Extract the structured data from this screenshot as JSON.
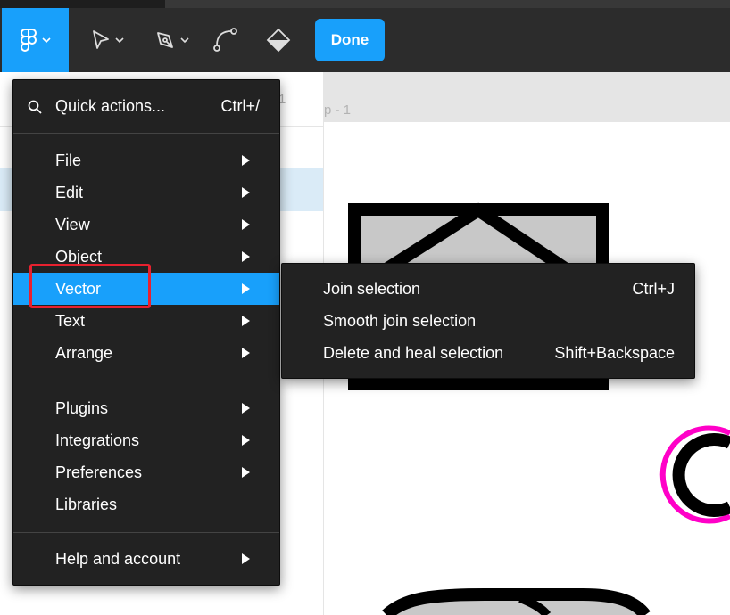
{
  "toolbar": {
    "done_label": "Done",
    "icons": [
      "figma-menu-icon",
      "move-tool-icon",
      "pen-tool-icon",
      "bend-tool-icon",
      "paint-bucket-icon"
    ],
    "accent_color": "#18a0fb"
  },
  "left_panel": {
    "page_indicator": "1"
  },
  "canvas": {
    "frame_label": "p - 1"
  },
  "menu": {
    "quick_actions": {
      "label": "Quick actions...",
      "shortcut": "Ctrl+/"
    },
    "items": [
      {
        "label": "File",
        "has_submenu": true
      },
      {
        "label": "Edit",
        "has_submenu": true
      },
      {
        "label": "View",
        "has_submenu": true
      },
      {
        "label": "Object",
        "has_submenu": true
      },
      {
        "label": "Vector",
        "has_submenu": true,
        "active": true
      },
      {
        "label": "Text",
        "has_submenu": true
      },
      {
        "label": "Arrange",
        "has_submenu": true
      }
    ],
    "group2": [
      {
        "label": "Plugins",
        "has_submenu": true
      },
      {
        "label": "Integrations",
        "has_submenu": true
      },
      {
        "label": "Preferences",
        "has_submenu": true
      },
      {
        "label": "Libraries",
        "has_submenu": false
      }
    ],
    "help": {
      "label": "Help and account",
      "has_submenu": true
    }
  },
  "submenu": {
    "items": [
      {
        "label": "Join selection",
        "shortcut": "Ctrl+J"
      },
      {
        "label": "Smooth join selection",
        "shortcut": ""
      },
      {
        "label": "Delete and heal selection",
        "shortcut": "Shift+Backspace"
      }
    ]
  }
}
